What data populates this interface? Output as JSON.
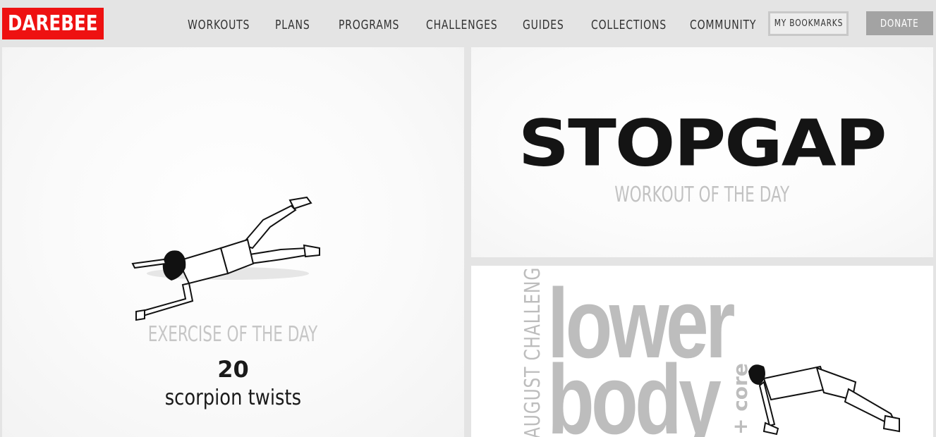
{
  "header": {
    "logo": "DAREBEE",
    "nav": [
      "WORKOUTS",
      "PLANS",
      "PROGRAMS",
      "CHALLENGES",
      "GUIDES",
      "COLLECTIONS",
      "COMMUNITY"
    ],
    "bookmarks_label": "MY BOOKMARKS",
    "donate_label": "DONATE"
  },
  "exercise_of_day": {
    "label": "EXERCISE OF THE DAY",
    "count": "20",
    "name": "scorpion twists"
  },
  "workout_of_day": {
    "title": "STOPGAP",
    "label": "WORKOUT OF THE DAY"
  },
  "challenge": {
    "vertical_label": "AUGUST CHALLENGE",
    "word1": "lower",
    "word2": "body",
    "side_label": "+ core"
  },
  "colors": {
    "brand_red": "#ee1111",
    "background": "#e4e4e4",
    "donate_bg": "#a3a3a3"
  }
}
